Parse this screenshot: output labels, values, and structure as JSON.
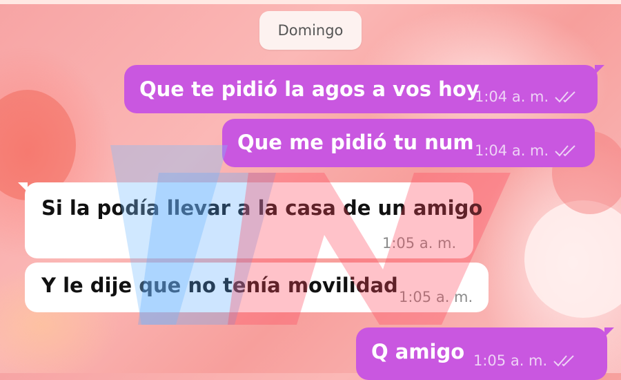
{
  "date_separator": "Domingo",
  "messages": [
    {
      "direction": "out",
      "text": "Que te pidió la agos a vos hoy",
      "time": "1:04 a. m.",
      "status_icon": "double-check-icon"
    },
    {
      "direction": "out",
      "text": "Que me pidió tu num",
      "time": "1:04 a. m.",
      "status_icon": "double-check-icon"
    },
    {
      "direction": "in",
      "text": "Si la podía llevar a la casa de un amigo",
      "time": "1:05 a. m."
    },
    {
      "direction": "in",
      "text": "Y le dije que no tenía movilidad",
      "time": "1:05 a. m."
    },
    {
      "direction": "out",
      "text": "Q amigo",
      "time": "1:05 a. m.",
      "status_icon": "double-check-icon"
    }
  ],
  "colors": {
    "outgoing_bubble": "#c957e0",
    "incoming_bubble": "#ffffff",
    "background": "#f7a4a4"
  }
}
